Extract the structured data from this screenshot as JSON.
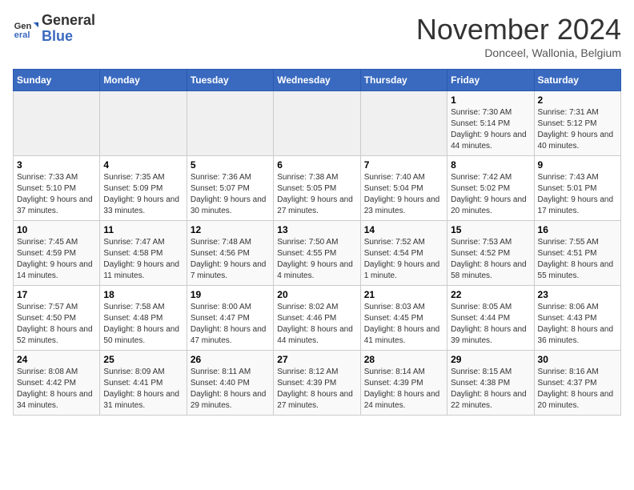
{
  "logo": {
    "text_line1": "General",
    "text_line2": "Blue"
  },
  "header": {
    "month_year": "November 2024",
    "location": "Donceel, Wallonia, Belgium"
  },
  "weekdays": [
    "Sunday",
    "Monday",
    "Tuesday",
    "Wednesday",
    "Thursday",
    "Friday",
    "Saturday"
  ],
  "weeks": [
    [
      {
        "day": "",
        "info": ""
      },
      {
        "day": "",
        "info": ""
      },
      {
        "day": "",
        "info": ""
      },
      {
        "day": "",
        "info": ""
      },
      {
        "day": "",
        "info": ""
      },
      {
        "day": "1",
        "info": "Sunrise: 7:30 AM\nSunset: 5:14 PM\nDaylight: 9 hours and 44 minutes."
      },
      {
        "day": "2",
        "info": "Sunrise: 7:31 AM\nSunset: 5:12 PM\nDaylight: 9 hours and 40 minutes."
      }
    ],
    [
      {
        "day": "3",
        "info": "Sunrise: 7:33 AM\nSunset: 5:10 PM\nDaylight: 9 hours and 37 minutes."
      },
      {
        "day": "4",
        "info": "Sunrise: 7:35 AM\nSunset: 5:09 PM\nDaylight: 9 hours and 33 minutes."
      },
      {
        "day": "5",
        "info": "Sunrise: 7:36 AM\nSunset: 5:07 PM\nDaylight: 9 hours and 30 minutes."
      },
      {
        "day": "6",
        "info": "Sunrise: 7:38 AM\nSunset: 5:05 PM\nDaylight: 9 hours and 27 minutes."
      },
      {
        "day": "7",
        "info": "Sunrise: 7:40 AM\nSunset: 5:04 PM\nDaylight: 9 hours and 23 minutes."
      },
      {
        "day": "8",
        "info": "Sunrise: 7:42 AM\nSunset: 5:02 PM\nDaylight: 9 hours and 20 minutes."
      },
      {
        "day": "9",
        "info": "Sunrise: 7:43 AM\nSunset: 5:01 PM\nDaylight: 9 hours and 17 minutes."
      }
    ],
    [
      {
        "day": "10",
        "info": "Sunrise: 7:45 AM\nSunset: 4:59 PM\nDaylight: 9 hours and 14 minutes."
      },
      {
        "day": "11",
        "info": "Sunrise: 7:47 AM\nSunset: 4:58 PM\nDaylight: 9 hours and 11 minutes."
      },
      {
        "day": "12",
        "info": "Sunrise: 7:48 AM\nSunset: 4:56 PM\nDaylight: 9 hours and 7 minutes."
      },
      {
        "day": "13",
        "info": "Sunrise: 7:50 AM\nSunset: 4:55 PM\nDaylight: 9 hours and 4 minutes."
      },
      {
        "day": "14",
        "info": "Sunrise: 7:52 AM\nSunset: 4:54 PM\nDaylight: 9 hours and 1 minute."
      },
      {
        "day": "15",
        "info": "Sunrise: 7:53 AM\nSunset: 4:52 PM\nDaylight: 8 hours and 58 minutes."
      },
      {
        "day": "16",
        "info": "Sunrise: 7:55 AM\nSunset: 4:51 PM\nDaylight: 8 hours and 55 minutes."
      }
    ],
    [
      {
        "day": "17",
        "info": "Sunrise: 7:57 AM\nSunset: 4:50 PM\nDaylight: 8 hours and 52 minutes."
      },
      {
        "day": "18",
        "info": "Sunrise: 7:58 AM\nSunset: 4:48 PM\nDaylight: 8 hours and 50 minutes."
      },
      {
        "day": "19",
        "info": "Sunrise: 8:00 AM\nSunset: 4:47 PM\nDaylight: 8 hours and 47 minutes."
      },
      {
        "day": "20",
        "info": "Sunrise: 8:02 AM\nSunset: 4:46 PM\nDaylight: 8 hours and 44 minutes."
      },
      {
        "day": "21",
        "info": "Sunrise: 8:03 AM\nSunset: 4:45 PM\nDaylight: 8 hours and 41 minutes."
      },
      {
        "day": "22",
        "info": "Sunrise: 8:05 AM\nSunset: 4:44 PM\nDaylight: 8 hours and 39 minutes."
      },
      {
        "day": "23",
        "info": "Sunrise: 8:06 AM\nSunset: 4:43 PM\nDaylight: 8 hours and 36 minutes."
      }
    ],
    [
      {
        "day": "24",
        "info": "Sunrise: 8:08 AM\nSunset: 4:42 PM\nDaylight: 8 hours and 34 minutes."
      },
      {
        "day": "25",
        "info": "Sunrise: 8:09 AM\nSunset: 4:41 PM\nDaylight: 8 hours and 31 minutes."
      },
      {
        "day": "26",
        "info": "Sunrise: 8:11 AM\nSunset: 4:40 PM\nDaylight: 8 hours and 29 minutes."
      },
      {
        "day": "27",
        "info": "Sunrise: 8:12 AM\nSunset: 4:39 PM\nDaylight: 8 hours and 27 minutes."
      },
      {
        "day": "28",
        "info": "Sunrise: 8:14 AM\nSunset: 4:39 PM\nDaylight: 8 hours and 24 minutes."
      },
      {
        "day": "29",
        "info": "Sunrise: 8:15 AM\nSunset: 4:38 PM\nDaylight: 8 hours and 22 minutes."
      },
      {
        "day": "30",
        "info": "Sunrise: 8:16 AM\nSunset: 4:37 PM\nDaylight: 8 hours and 20 minutes."
      }
    ]
  ]
}
